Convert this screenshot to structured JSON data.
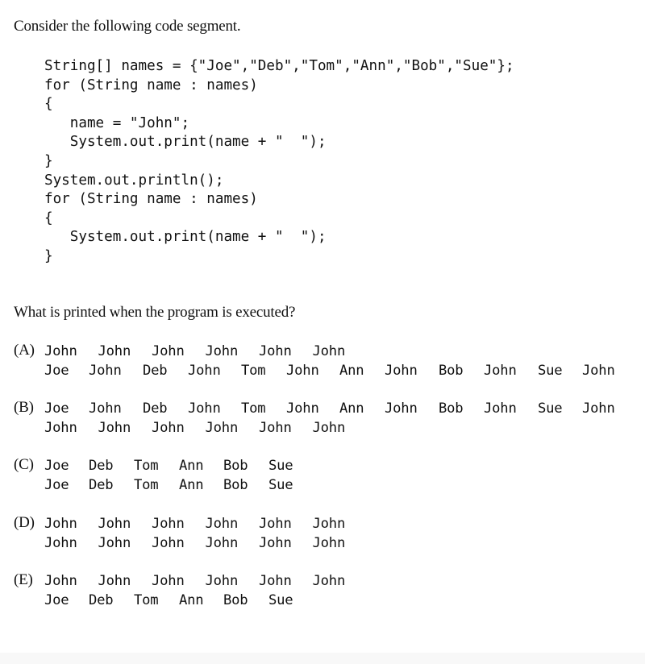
{
  "intro": "Consider the following code segment.",
  "code_lines": [
    "String[] names = {\"Joe\",\"Deb\",\"Tom\",\"Ann\",\"Bob\",\"Sue\"};",
    "for (String name : names)",
    "{",
    "   name = \"John\";",
    "   System.out.print(name + \"  \");",
    "}",
    "System.out.println();",
    "for (String name : names)",
    "{",
    "   System.out.print(name + \"  \");",
    "}"
  ],
  "question": "What is printed when the program is executed?",
  "options": [
    {
      "label": "(A)",
      "rows": [
        [
          "John",
          "John",
          "John",
          "John",
          "John",
          "John"
        ],
        [
          "Joe",
          "John",
          "Deb",
          "John",
          "Tom",
          "John",
          "Ann",
          "John",
          "Bob",
          "John",
          "Sue",
          "John"
        ]
      ]
    },
    {
      "label": "(B)",
      "rows": [
        [
          "Joe",
          "John",
          "Deb",
          "John",
          "Tom",
          "John",
          "Ann",
          "John",
          "Bob",
          "John",
          "Sue",
          "John"
        ],
        [
          "John",
          "John",
          "John",
          "John",
          "John",
          "John"
        ]
      ]
    },
    {
      "label": "(C)",
      "rows": [
        [
          "Joe",
          "Deb",
          "Tom",
          "Ann",
          "Bob",
          "Sue"
        ],
        [
          "Joe",
          "Deb",
          "Tom",
          "Ann",
          "Bob",
          "Sue"
        ]
      ]
    },
    {
      "label": "(D)",
      "rows": [
        [
          "John",
          "John",
          "John",
          "John",
          "John",
          "John"
        ],
        [
          "John",
          "John",
          "John",
          "John",
          "John",
          "John"
        ]
      ]
    },
    {
      "label": "(E)",
      "rows": [
        [
          "John",
          "John",
          "John",
          "John",
          "John",
          "John"
        ],
        [
          "Joe",
          "Deb",
          "Tom",
          "Ann",
          "Bob",
          "Sue"
        ]
      ]
    }
  ]
}
